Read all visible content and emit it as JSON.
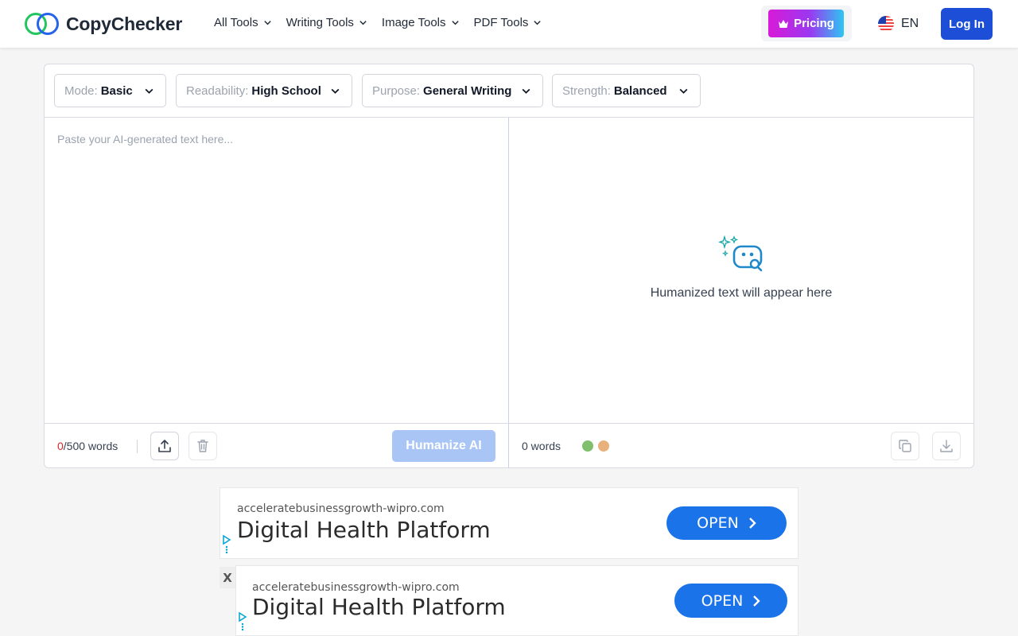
{
  "brand": {
    "name": "CopyChecker"
  },
  "nav": [
    {
      "label": "All Tools"
    },
    {
      "label": "Writing Tools"
    },
    {
      "label": "Image Tools"
    },
    {
      "label": "PDF Tools"
    }
  ],
  "header": {
    "pricing_label": "Pricing",
    "language": "EN",
    "login_label": "Log In"
  },
  "options": [
    {
      "prefix": "Mode:",
      "value": "Basic"
    },
    {
      "prefix": "Readability:",
      "value": "High School"
    },
    {
      "prefix": "Purpose:",
      "value": "General Writing"
    },
    {
      "prefix": "Strength:",
      "value": "Balanced"
    }
  ],
  "input": {
    "placeholder": "Paste your AI-generated text here...",
    "value": "",
    "count": "0",
    "limit_label": "/500 words"
  },
  "output": {
    "empty_text": "Humanized text will appear here",
    "word_count": "0 words"
  },
  "actions": {
    "humanize_label": "Humanize AI"
  },
  "colors": {
    "accent": "#1d4ed8",
    "humanize_disabled": "#a8c5f5",
    "dot_green": "#7fbf6e",
    "dot_orange": "#e8b07a",
    "icon_teal": "#0ea5a4"
  },
  "ads": [
    {
      "domain": "acceleratebusinessgrowth-wipro.com",
      "title": "Digital Health Platform",
      "cta": "OPEN"
    },
    {
      "domain": "acceleratebusinessgrowth-wipro.com",
      "title": "Digital Health Platform",
      "cta": "OPEN"
    }
  ],
  "ad_close": "X"
}
